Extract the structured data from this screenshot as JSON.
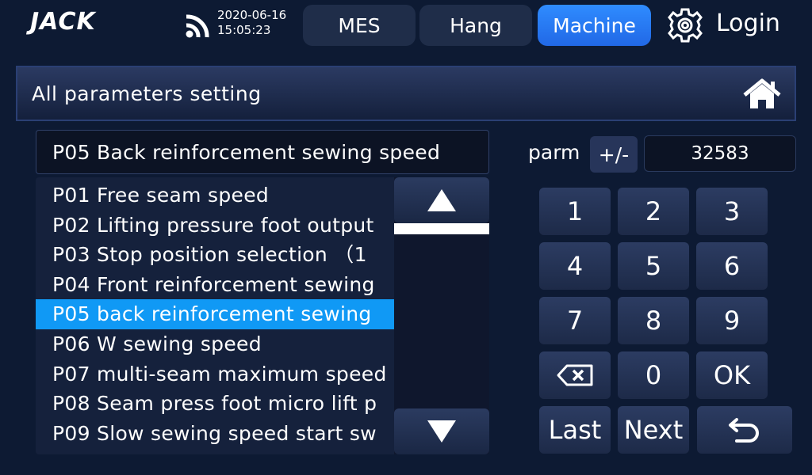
{
  "header": {
    "brand": "JACK",
    "date": "2020-06-16",
    "time": "15:05:23",
    "tabs": [
      {
        "label": "MES",
        "active": false
      },
      {
        "label": "Hang",
        "active": false
      },
      {
        "label": "Machine",
        "active": true
      }
    ],
    "login_label": "Login"
  },
  "page": {
    "title": "All parameters setting"
  },
  "selected_param": {
    "label": "P05  Back reinforcement sewing  speed"
  },
  "param_list": {
    "items": [
      "P01  Free seam speed",
      "P02  Lifting pressure foot output",
      "P03  Stop position selection （1",
      "P04  Front  reinforcement sewing",
      "P05   back reinforcement sewing",
      "P06  W sewing speed",
      "P07  multi-seam maximum speed",
      "P08  Seam press foot micro lift p",
      "P09  Slow sewing speed start sw"
    ],
    "selected_index": 4
  },
  "keypad": {
    "parm_label": "parm",
    "sign_label": "+/-",
    "value": "32583",
    "keys": {
      "k1": "1",
      "k2": "2",
      "k3": "3",
      "k4": "4",
      "k5": "5",
      "k6": "6",
      "k7": "7",
      "k8": "8",
      "k9": "9",
      "k0": "0",
      "ok": "OK",
      "last": "Last",
      "next": "Next"
    }
  },
  "icons": {
    "wifi": "wifi-icon",
    "settings": "gear-icon",
    "home": "home-icon",
    "backspace": "backspace-icon",
    "back": "return-icon",
    "scroll_up": "triangle-up-icon",
    "scroll_down": "triangle-down-icon"
  },
  "colors": {
    "background": "#0d1a33",
    "accent": "#2f8cff",
    "selection": "#1099f5"
  }
}
